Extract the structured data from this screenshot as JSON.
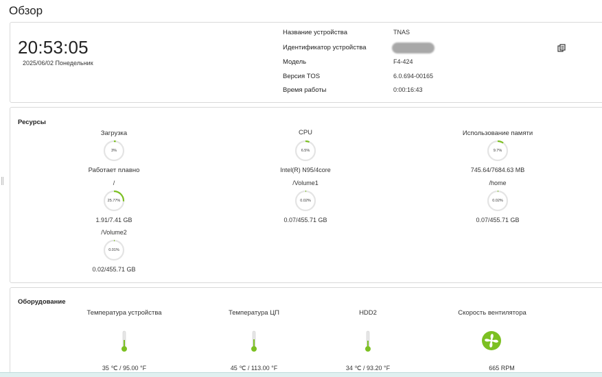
{
  "page": {
    "title": "Обзор"
  },
  "system": {
    "time": "20:53:05",
    "date": "2025/06/02 Понедельник",
    "rows": [
      {
        "label": "Название устройства",
        "value": "TNAS"
      },
      {
        "label": "Идентификатор устройства",
        "value": ""
      },
      {
        "label": "Модель",
        "value": "F4-424"
      },
      {
        "label": "Версия TOS",
        "value": "6.0.694-00165"
      },
      {
        "label": "Время работы",
        "value": "0:00:16:43"
      }
    ],
    "copy_icon": "copy-icon"
  },
  "resources": {
    "title": "Ресурсы",
    "load": {
      "label": "Загрузка",
      "pct_text": "3%",
      "fraction": 0.03,
      "status": "Работает плавно"
    },
    "cpu": {
      "label": "CPU",
      "pct_text": "6.5%",
      "fraction": 0.065,
      "detail": "Intel(R) N95/4core"
    },
    "memory": {
      "label": "Использование памяти",
      "pct_text": "9.7%",
      "fraction": 0.097,
      "detail": "745.64/7684.63 MB"
    },
    "root": {
      "label": "/",
      "pct_text": "25.77%",
      "fraction": 0.2577,
      "detail": "1.91/7.41 GB"
    },
    "volume1": {
      "label": "/Volume1",
      "pct_text": "0.02%",
      "fraction": 0.0002,
      "detail": "0.07/455.71 GB"
    },
    "home": {
      "label": "/home",
      "pct_text": "0.02%",
      "fraction": 0.0002,
      "detail": "0.07/455.71 GB"
    },
    "volume2": {
      "label": "/Volume2",
      "pct_text": "0.01%",
      "fraction": 0.0001,
      "detail": "0.02/455.71 GB"
    }
  },
  "hardware": {
    "title": "Оборудование",
    "device_temp": {
      "label": "Температура устройства",
      "value": "35 ℃ / 95.00 °F",
      "icon": "thermometer-icon"
    },
    "cpu_temp": {
      "label": "Температура ЦП",
      "value": "45 ℃ / 113.00 °F",
      "icon": "thermometer-icon"
    },
    "hdd2": {
      "label": "HDD2",
      "value": "34 ℃ / 93.20 °F",
      "icon": "thermometer-icon"
    },
    "fan": {
      "label": "Скорость вентилятора",
      "value": "665 RPM",
      "icon": "fan-icon"
    }
  },
  "colors": {
    "accent": "#7cc022",
    "track": "#e4e4e4"
  }
}
